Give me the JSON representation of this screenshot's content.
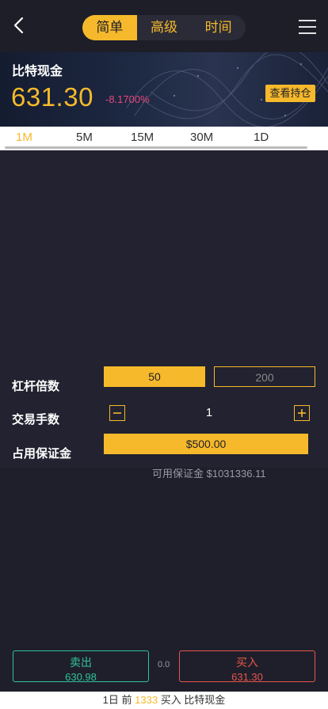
{
  "header": {
    "tabs": [
      {
        "label": "简单",
        "active": true
      },
      {
        "label": "高级",
        "active": false
      },
      {
        "label": "时间",
        "active": false
      }
    ]
  },
  "banner": {
    "asset_name": "比特现金",
    "price": "631.30",
    "change": "-8.1700%",
    "positions_label": "查看持仓"
  },
  "timeframes": [
    {
      "label": "1M",
      "active": true
    },
    {
      "label": "5M",
      "active": false
    },
    {
      "label": "15M",
      "active": false
    },
    {
      "label": "30M",
      "active": false
    },
    {
      "label": "1D",
      "active": false
    }
  ],
  "trade": {
    "leverage_label": "杠杆倍数",
    "leverage_options": [
      "50",
      "200"
    ],
    "leverage_selected": "50",
    "quantity_label": "交易手数",
    "quantity_value": "1",
    "margin_label": "占用保证金",
    "margin_value": "$500.00",
    "available_margin": "可用保证金 $1031336.11"
  },
  "actions": {
    "sell_label": "卖出",
    "sell_price": "630.98",
    "spread": "0.0",
    "buy_label": "买入",
    "buy_price": "631.30"
  },
  "footer": {
    "prefix": "1日 前",
    "count": "1333",
    "suffix": "买入 比特现金"
  },
  "colors": {
    "accent": "#f6b92b",
    "sell": "#2fc49a",
    "buy": "#e6554a",
    "negative_change": "#e8487a",
    "background": "#1f1f2b"
  },
  "icons": [
    "back-icon",
    "menu-icon",
    "minus-icon",
    "plus-icon"
  ]
}
